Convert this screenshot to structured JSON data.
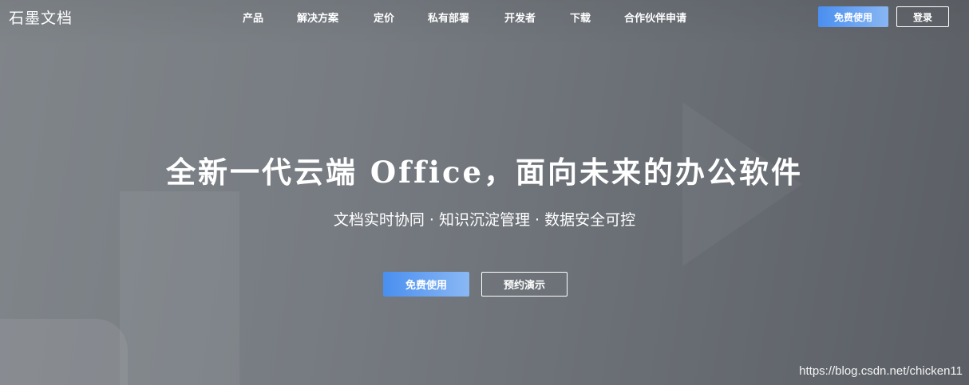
{
  "brand": {
    "logo_text": "石墨文档"
  },
  "nav": {
    "items": [
      {
        "label": "产品"
      },
      {
        "label": "解决方案"
      },
      {
        "label": "定价"
      },
      {
        "label": "私有部署"
      },
      {
        "label": "开发者"
      },
      {
        "label": "下载"
      },
      {
        "label": "合作伙伴申请"
      }
    ]
  },
  "header_actions": {
    "free_use_label": "免费使用",
    "login_label": "登录"
  },
  "hero": {
    "headline": "全新一代云端 Office，面向未来的办公软件",
    "subline": "文档实时协同 · 知识沉淀管理 · 数据安全可控",
    "primary_cta_label": "免费使用",
    "secondary_cta_label": "预约演示"
  },
  "watermark": {
    "text": "https://blog.csdn.net/chicken11"
  },
  "colors": {
    "accent_start": "#4a8ff0",
    "accent_end": "#88b6f3",
    "background": "#6e7379",
    "text": "#ffffff"
  }
}
